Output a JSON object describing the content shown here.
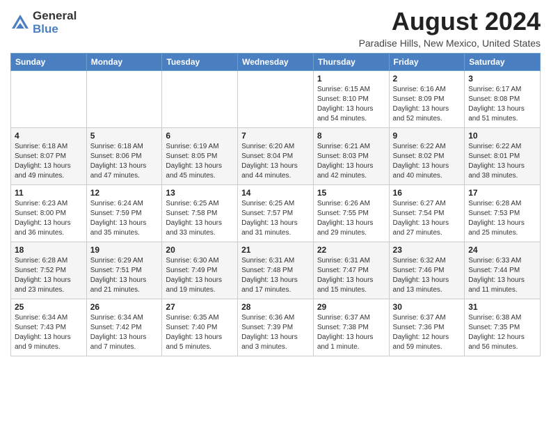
{
  "logo": {
    "general": "General",
    "blue": "Blue"
  },
  "title": "August 2024",
  "subtitle": "Paradise Hills, New Mexico, United States",
  "weekdays": [
    "Sunday",
    "Monday",
    "Tuesday",
    "Wednesday",
    "Thursday",
    "Friday",
    "Saturday"
  ],
  "weeks": [
    [
      {
        "day": "",
        "info": ""
      },
      {
        "day": "",
        "info": ""
      },
      {
        "day": "",
        "info": ""
      },
      {
        "day": "",
        "info": ""
      },
      {
        "day": "1",
        "info": "Sunrise: 6:15 AM\nSunset: 8:10 PM\nDaylight: 13 hours\nand 54 minutes."
      },
      {
        "day": "2",
        "info": "Sunrise: 6:16 AM\nSunset: 8:09 PM\nDaylight: 13 hours\nand 52 minutes."
      },
      {
        "day": "3",
        "info": "Sunrise: 6:17 AM\nSunset: 8:08 PM\nDaylight: 13 hours\nand 51 minutes."
      }
    ],
    [
      {
        "day": "4",
        "info": "Sunrise: 6:18 AM\nSunset: 8:07 PM\nDaylight: 13 hours\nand 49 minutes."
      },
      {
        "day": "5",
        "info": "Sunrise: 6:18 AM\nSunset: 8:06 PM\nDaylight: 13 hours\nand 47 minutes."
      },
      {
        "day": "6",
        "info": "Sunrise: 6:19 AM\nSunset: 8:05 PM\nDaylight: 13 hours\nand 45 minutes."
      },
      {
        "day": "7",
        "info": "Sunrise: 6:20 AM\nSunset: 8:04 PM\nDaylight: 13 hours\nand 44 minutes."
      },
      {
        "day": "8",
        "info": "Sunrise: 6:21 AM\nSunset: 8:03 PM\nDaylight: 13 hours\nand 42 minutes."
      },
      {
        "day": "9",
        "info": "Sunrise: 6:22 AM\nSunset: 8:02 PM\nDaylight: 13 hours\nand 40 minutes."
      },
      {
        "day": "10",
        "info": "Sunrise: 6:22 AM\nSunset: 8:01 PM\nDaylight: 13 hours\nand 38 minutes."
      }
    ],
    [
      {
        "day": "11",
        "info": "Sunrise: 6:23 AM\nSunset: 8:00 PM\nDaylight: 13 hours\nand 36 minutes."
      },
      {
        "day": "12",
        "info": "Sunrise: 6:24 AM\nSunset: 7:59 PM\nDaylight: 13 hours\nand 35 minutes."
      },
      {
        "day": "13",
        "info": "Sunrise: 6:25 AM\nSunset: 7:58 PM\nDaylight: 13 hours\nand 33 minutes."
      },
      {
        "day": "14",
        "info": "Sunrise: 6:25 AM\nSunset: 7:57 PM\nDaylight: 13 hours\nand 31 minutes."
      },
      {
        "day": "15",
        "info": "Sunrise: 6:26 AM\nSunset: 7:55 PM\nDaylight: 13 hours\nand 29 minutes."
      },
      {
        "day": "16",
        "info": "Sunrise: 6:27 AM\nSunset: 7:54 PM\nDaylight: 13 hours\nand 27 minutes."
      },
      {
        "day": "17",
        "info": "Sunrise: 6:28 AM\nSunset: 7:53 PM\nDaylight: 13 hours\nand 25 minutes."
      }
    ],
    [
      {
        "day": "18",
        "info": "Sunrise: 6:28 AM\nSunset: 7:52 PM\nDaylight: 13 hours\nand 23 minutes."
      },
      {
        "day": "19",
        "info": "Sunrise: 6:29 AM\nSunset: 7:51 PM\nDaylight: 13 hours\nand 21 minutes."
      },
      {
        "day": "20",
        "info": "Sunrise: 6:30 AM\nSunset: 7:49 PM\nDaylight: 13 hours\nand 19 minutes."
      },
      {
        "day": "21",
        "info": "Sunrise: 6:31 AM\nSunset: 7:48 PM\nDaylight: 13 hours\nand 17 minutes."
      },
      {
        "day": "22",
        "info": "Sunrise: 6:31 AM\nSunset: 7:47 PM\nDaylight: 13 hours\nand 15 minutes."
      },
      {
        "day": "23",
        "info": "Sunrise: 6:32 AM\nSunset: 7:46 PM\nDaylight: 13 hours\nand 13 minutes."
      },
      {
        "day": "24",
        "info": "Sunrise: 6:33 AM\nSunset: 7:44 PM\nDaylight: 13 hours\nand 11 minutes."
      }
    ],
    [
      {
        "day": "25",
        "info": "Sunrise: 6:34 AM\nSunset: 7:43 PM\nDaylight: 13 hours\nand 9 minutes."
      },
      {
        "day": "26",
        "info": "Sunrise: 6:34 AM\nSunset: 7:42 PM\nDaylight: 13 hours\nand 7 minutes."
      },
      {
        "day": "27",
        "info": "Sunrise: 6:35 AM\nSunset: 7:40 PM\nDaylight: 13 hours\nand 5 minutes."
      },
      {
        "day": "28",
        "info": "Sunrise: 6:36 AM\nSunset: 7:39 PM\nDaylight: 13 hours\nand 3 minutes."
      },
      {
        "day": "29",
        "info": "Sunrise: 6:37 AM\nSunset: 7:38 PM\nDaylight: 13 hours\nand 1 minute."
      },
      {
        "day": "30",
        "info": "Sunrise: 6:37 AM\nSunset: 7:36 PM\nDaylight: 12 hours\nand 59 minutes."
      },
      {
        "day": "31",
        "info": "Sunrise: 6:38 AM\nSunset: 7:35 PM\nDaylight: 12 hours\nand 56 minutes."
      }
    ]
  ]
}
